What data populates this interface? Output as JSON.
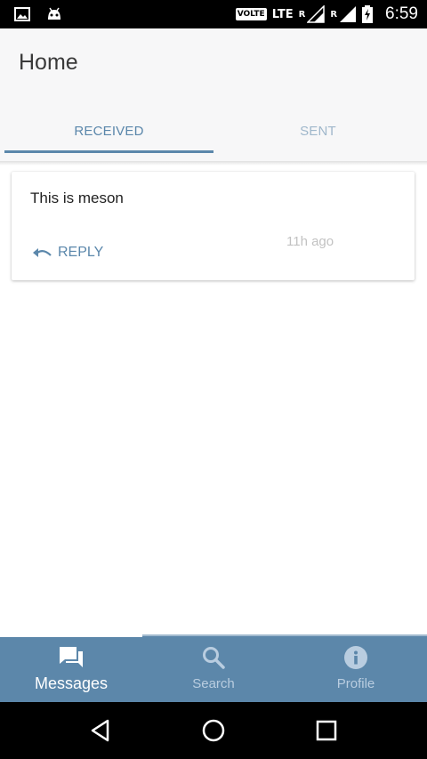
{
  "status_bar": {
    "volte": "VOLTE",
    "lte": "LTE",
    "roaming_1": "R",
    "roaming_2": "R",
    "time": "6:59",
    "icons": [
      "gallery-icon",
      "android-icon",
      "signal-icon",
      "battery-charging-icon"
    ]
  },
  "header": {
    "title": "Home",
    "tabs": [
      {
        "label": "RECEIVED",
        "active": true
      },
      {
        "label": "SENT",
        "active": false
      }
    ]
  },
  "messages": [
    {
      "text": "This is meson",
      "reply_label": "REPLY",
      "time": "11h ago"
    }
  ],
  "bottom_nav": {
    "items": [
      {
        "label": "Messages",
        "icon": "chat-icon",
        "active": true
      },
      {
        "label": "Search",
        "icon": "search-icon",
        "active": false
      },
      {
        "label": "Profile",
        "icon": "info-icon",
        "active": false
      }
    ]
  },
  "colors": {
    "accent": "#5b87ab",
    "bottom_nav_bg": "#5c87aa",
    "inactive_tab": "#9fb7cb"
  }
}
